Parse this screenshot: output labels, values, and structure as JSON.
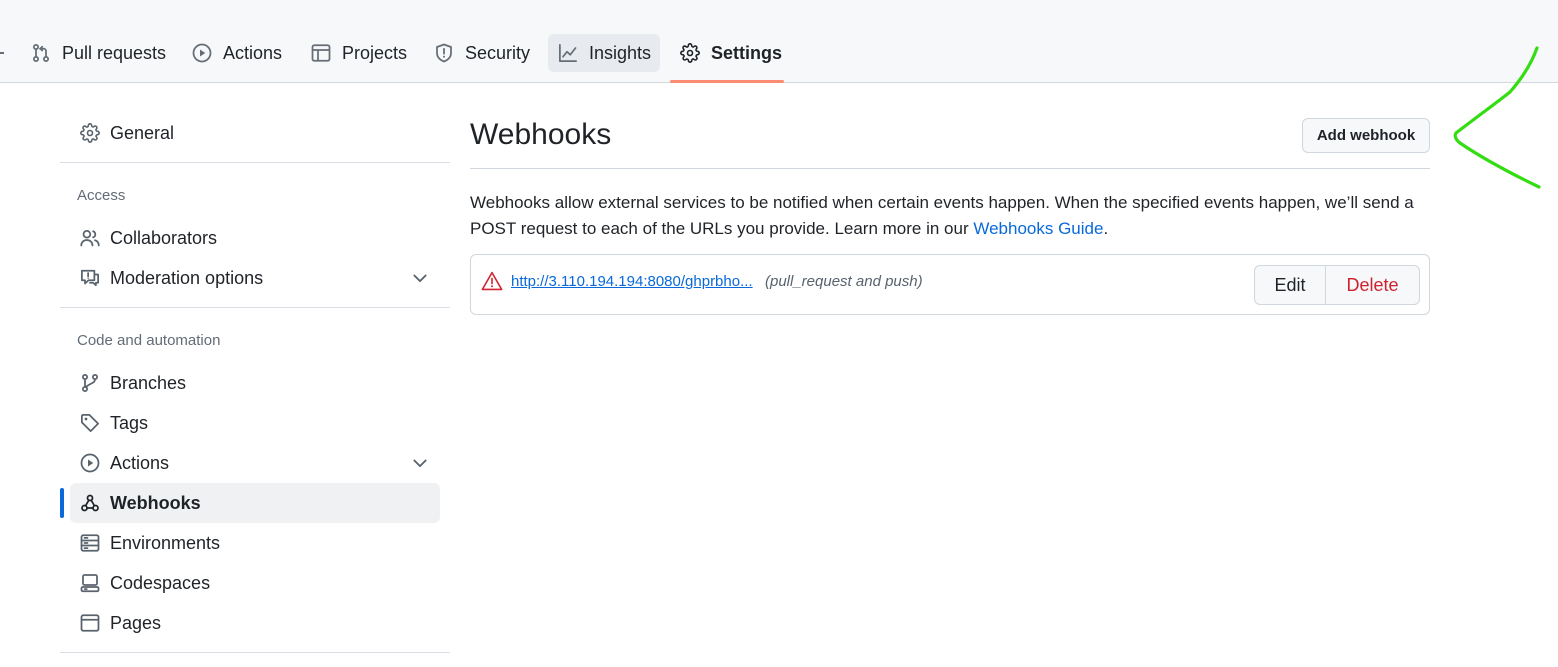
{
  "repo_nav": {
    "tabs": [
      {
        "label": "Pull requests",
        "icon": "git-pull-request-icon"
      },
      {
        "label": "Actions",
        "icon": "play-circle-icon"
      },
      {
        "label": "Projects",
        "icon": "table-icon"
      },
      {
        "label": "Security",
        "icon": "shield-icon"
      },
      {
        "label": "Insights",
        "icon": "graph-icon"
      },
      {
        "label": "Settings",
        "icon": "gear-icon"
      }
    ],
    "active_tab": "Settings"
  },
  "sidebar": {
    "general": "General",
    "access_heading": "Access",
    "access_items": [
      {
        "label": "Collaborators",
        "icon": "people-icon"
      },
      {
        "label": "Moderation options",
        "icon": "comment-report-icon",
        "expandable": true
      }
    ],
    "code_heading": "Code and automation",
    "code_items": [
      {
        "label": "Branches",
        "icon": "git-branch-icon"
      },
      {
        "label": "Tags",
        "icon": "tag-icon"
      },
      {
        "label": "Actions",
        "icon": "play-circle-icon",
        "expandable": true
      },
      {
        "label": "Webhooks",
        "icon": "webhook-icon",
        "active": true
      },
      {
        "label": "Environments",
        "icon": "server-icon"
      },
      {
        "label": "Codespaces",
        "icon": "codespaces-icon"
      },
      {
        "label": "Pages",
        "icon": "browser-icon"
      }
    ]
  },
  "main": {
    "title": "Webhooks",
    "add_button": "Add webhook",
    "description_before_link": "Webhooks allow external services to be notified when certain events happen. When the specified events happen, we’ll send a POST request to each of the URLs you provide. Learn more in our ",
    "description_link": "Webhooks Guide",
    "description_after_link": ".",
    "webhooks": [
      {
        "url": "http://3.110.194.194:8080/ghprbho...",
        "events": "(pull_request and push)",
        "status_icon": "alert-icon",
        "edit_label": "Edit",
        "delete_label": "Delete"
      }
    ]
  },
  "colors": {
    "accent_blue": "#0969da",
    "danger_red": "#cf222e",
    "tab_underline": "#fd8c73",
    "annotation_green": "#33dd11"
  }
}
